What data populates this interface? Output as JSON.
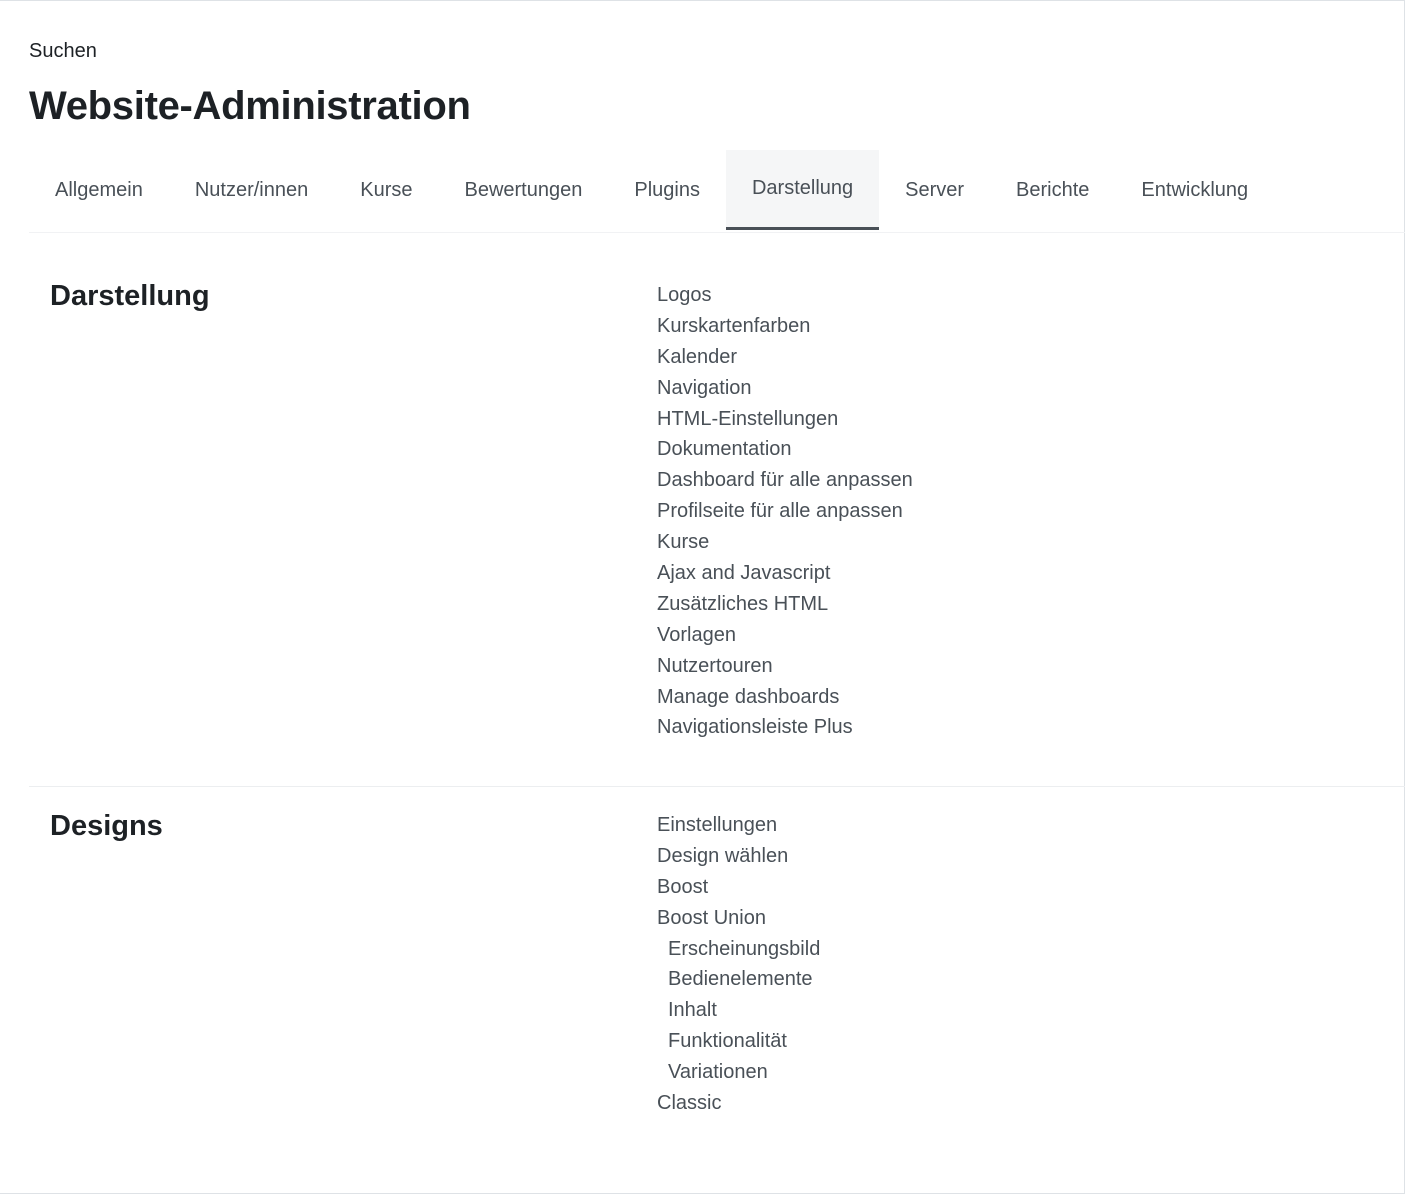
{
  "header": {
    "search_link": "Suchen",
    "title": "Website-Administration"
  },
  "tabs": [
    {
      "label": "Allgemein",
      "active": false
    },
    {
      "label": "Nutzer/innen",
      "active": false
    },
    {
      "label": "Kurse",
      "active": false
    },
    {
      "label": "Bewertungen",
      "active": false
    },
    {
      "label": "Plugins",
      "active": false
    },
    {
      "label": "Darstellung",
      "active": true
    },
    {
      "label": "Server",
      "active": false
    },
    {
      "label": "Berichte",
      "active": false
    },
    {
      "label": "Entwicklung",
      "active": false
    }
  ],
  "sections": {
    "darstellung": {
      "title": "Darstellung",
      "items": [
        "Logos",
        "Kurskartenfarben",
        "Kalender",
        "Navigation",
        "HTML-Einstellungen",
        "Dokumentation",
        "Dashboard für alle anpassen",
        "Profilseite für alle anpassen",
        "Kurse",
        "Ajax and Javascript",
        "Zusätzliches HTML",
        "Vorlagen",
        "Nutzertouren",
        "Manage dashboards",
        "Navigationsleiste Plus"
      ]
    },
    "designs": {
      "title": "Designs",
      "items": [
        "Einstellungen",
        "Design wählen",
        "Boost",
        "Boost Union",
        "Erscheinungsbild",
        "Bedienelemente",
        "Inhalt",
        "Funktionalität",
        "Variationen",
        "Classic"
      ]
    }
  },
  "colors": {
    "text_dark": "#1d2125",
    "text_muted": "#495057",
    "active_tab_bg": "#f5f6f7"
  }
}
